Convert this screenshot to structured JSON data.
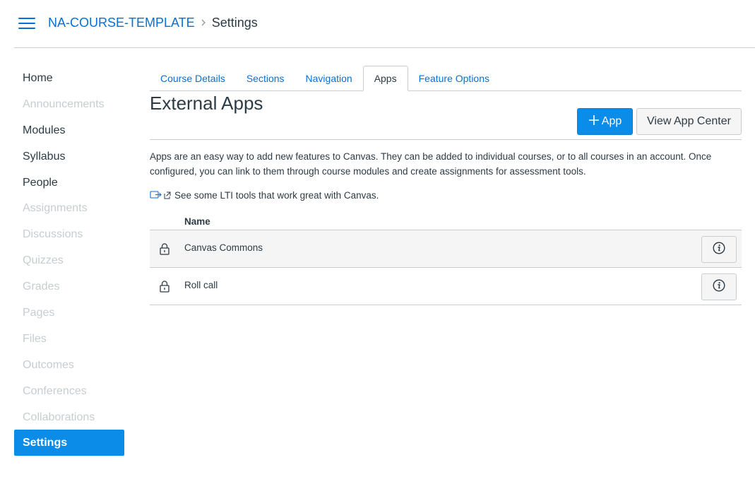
{
  "header": {
    "course_name": "NA-COURSE-TEMPLATE",
    "current_page": "Settings"
  },
  "sidebar": {
    "items": [
      {
        "label": "Home",
        "state": "enabled"
      },
      {
        "label": "Announcements",
        "state": "disabled"
      },
      {
        "label": "Modules",
        "state": "enabled"
      },
      {
        "label": "Syllabus",
        "state": "enabled"
      },
      {
        "label": "People",
        "state": "enabled"
      },
      {
        "label": "Assignments",
        "state": "disabled"
      },
      {
        "label": "Discussions",
        "state": "disabled"
      },
      {
        "label": "Quizzes",
        "state": "disabled"
      },
      {
        "label": "Grades",
        "state": "disabled"
      },
      {
        "label": "Pages",
        "state": "disabled"
      },
      {
        "label": "Files",
        "state": "disabled"
      },
      {
        "label": "Outcomes",
        "state": "disabled"
      },
      {
        "label": "Conferences",
        "state": "disabled"
      },
      {
        "label": "Collaborations",
        "state": "disabled"
      },
      {
        "label": "Settings",
        "state": "active"
      }
    ]
  },
  "tabs": [
    {
      "label": "Course Details"
    },
    {
      "label": "Sections"
    },
    {
      "label": "Navigation"
    },
    {
      "label": "Apps",
      "active": true
    },
    {
      "label": "Feature Options"
    }
  ],
  "main": {
    "title": "External Apps",
    "add_app_label": "App",
    "add_app_icon": "plus-icon",
    "view_app_center_label": "View App Center",
    "description": "Apps are an easy way to add new features to Canvas. They can be added to individual courses, or to all courses in an account. Once configured, you can link to them through course modules and create assignments for assessment tools.",
    "lti_link_text": "See some LTI tools that work great with Canvas."
  },
  "apps_table": {
    "column_header": "Name",
    "rows": [
      {
        "name": "Canvas Commons",
        "icon": "lock-icon",
        "action_icon": "info-icon"
      },
      {
        "name": "Roll call",
        "icon": "lock-icon",
        "action_icon": "info-icon"
      }
    ]
  },
  "colors": {
    "link": "#0770d8",
    "primary_button": "#0b8ce9",
    "text": "#2d3b45",
    "disabled_text": "#c7cdd1",
    "border": "#c7cdd1"
  }
}
